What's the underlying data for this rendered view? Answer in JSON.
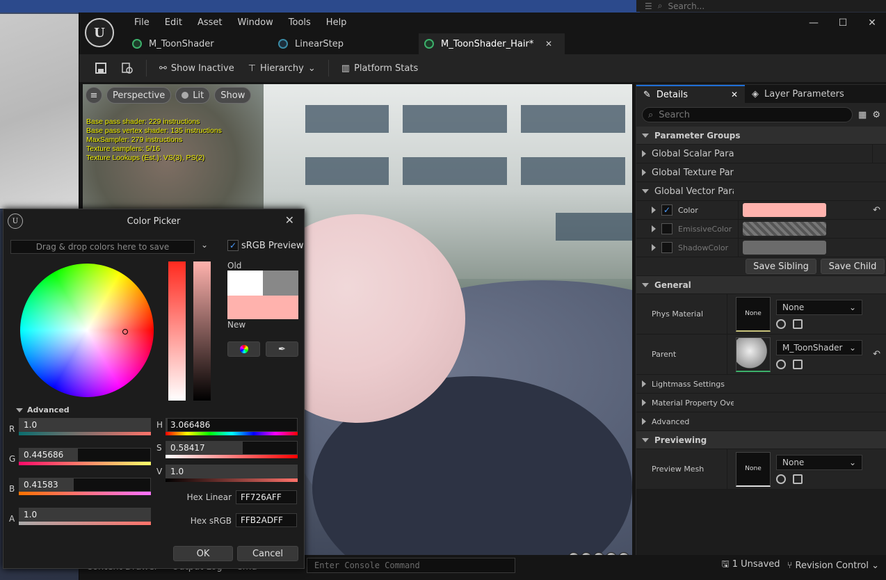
{
  "background": {
    "search_placeholder": "Search..."
  },
  "menu": {
    "items": [
      "File",
      "Edit",
      "Asset",
      "Window",
      "Tools",
      "Help"
    ]
  },
  "tabs": [
    {
      "label": "M_ToonShader"
    },
    {
      "label": "LinearStep"
    },
    {
      "label": "M_ToonShader_Hair*"
    }
  ],
  "toolbar": {
    "show_inactive": "Show Inactive",
    "hierarchy": "Hierarchy",
    "platform_stats": "Platform Stats"
  },
  "viewport": {
    "perspective": "Perspective",
    "lit": "Lit",
    "show": "Show",
    "stats": [
      "Base pass shader: 229 instructions",
      "Base pass vertex shader: 135 instructions",
      "MaxSampler: 279 instructions",
      "Texture samplers: 5/16",
      "Texture Lookups (Est.): VS(3), PS(2)"
    ]
  },
  "details": {
    "tab_details": "Details",
    "tab_layer": "Layer Parameters",
    "search_placeholder": "Search",
    "param_groups": "Parameter Groups",
    "global_scalar": "Global Scalar Parai",
    "global_texture": "Global Texture Par",
    "global_vector": "Global Vector Para",
    "color_label": "Color",
    "emissive_label": "EmissiveColor",
    "shadow_label": "ShadowColor",
    "color_value": "#ffb2ad",
    "save_sibling": "Save Sibling",
    "save_child": "Save Child",
    "general": "General",
    "phys_material": "Phys Material",
    "none_thumb": "None",
    "none_dd": "None",
    "parent": "Parent",
    "parent_value": "M_ToonShader",
    "lightmass": "Lightmass Settings",
    "matprop": "Material Property Ove",
    "advanced": "Advanced",
    "previewing": "Previewing",
    "preview_mesh": "Preview Mesh",
    "preview_none_thumb": "None",
    "preview_none_dd": "None"
  },
  "status": {
    "content_drawer": "Content Drawer",
    "output_log": "Output Log",
    "cmd": "Cmd",
    "console_placeholder": "Enter Console Command",
    "unsaved": "1 Unsaved",
    "revision": "Revision Control"
  },
  "picker": {
    "title": "Color Picker",
    "drop_hint": "Drag & drop colors here to save",
    "srgb": "sRGB Preview",
    "old": "Old",
    "new": "New",
    "advanced": "Advanced",
    "r_label": "R",
    "r": "1.0",
    "g_label": "G",
    "g": "0.445686",
    "b_label": "B",
    "b": "0.41583",
    "a_label": "A",
    "a": "1.0",
    "h_label": "H",
    "h": "3.066486",
    "s_label": "S",
    "s": "0.58417",
    "v_label": "V",
    "v": "1.0",
    "hex_linear_label": "Hex Linear",
    "hex_linear": "FF726AFF",
    "hex_srgb_label": "Hex sRGB",
    "hex_srgb": "FFB2ADFF",
    "ok": "OK",
    "cancel": "Cancel",
    "new_color": "#ffb2ad"
  }
}
